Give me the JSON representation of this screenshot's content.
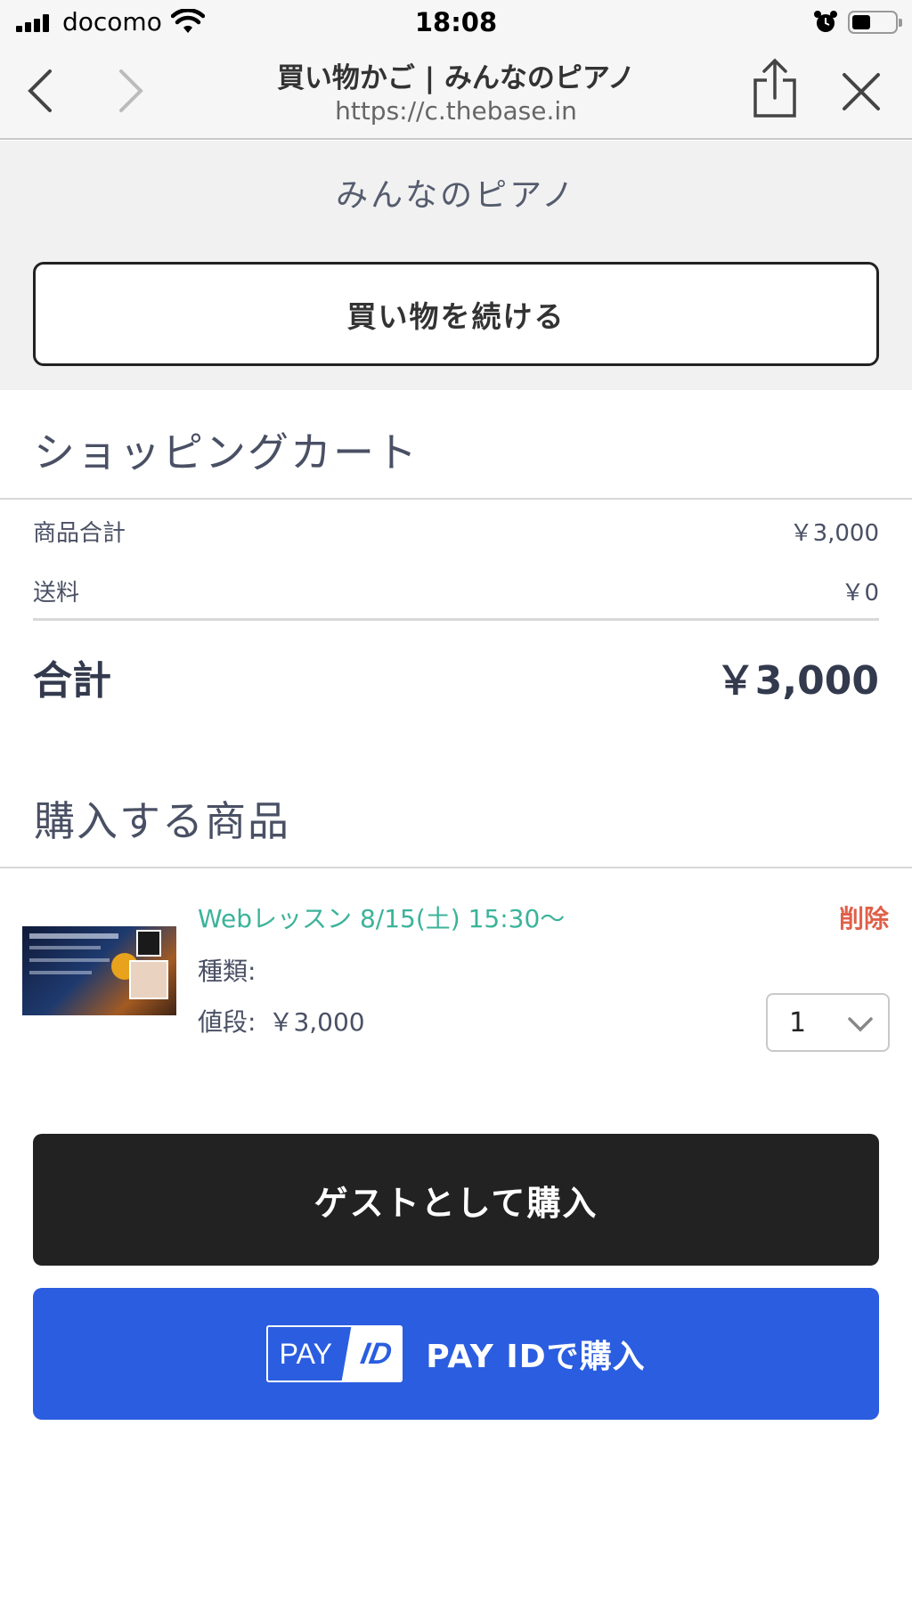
{
  "status_bar": {
    "carrier": "docomo",
    "time": "18:08"
  },
  "browser": {
    "title": "買い物かご | みんなのピアノ",
    "url": "https://c.thebase.in"
  },
  "shop": {
    "name": "みんなのピアノ",
    "continue_label": "買い物を続ける"
  },
  "cart": {
    "title": "ショッピングカート",
    "subtotal_label": "商品合計",
    "subtotal_value": "￥3,000",
    "shipping_label": "送料",
    "shipping_value": "￥0",
    "total_label": "合計",
    "total_value": "￥3,000"
  },
  "items_section": {
    "title": "購入する商品",
    "items": [
      {
        "name": "Webレッスン 8/15(土) 15:30〜",
        "delete_label": "削除",
        "type_label": "種類:",
        "price_label": "値段:",
        "price_value": "￥3,000",
        "quantity": "1"
      }
    ]
  },
  "buttons": {
    "guest_purchase": "ゲストとして購入",
    "payid_logo_pay": "PAY",
    "payid_logo_id": "ID",
    "payid_purchase": "PAY IDで購入"
  },
  "colors": {
    "product_link": "#3bb39a",
    "delete": "#e0604a",
    "guest_button": "#222222",
    "payid_button": "#2b5de0"
  }
}
